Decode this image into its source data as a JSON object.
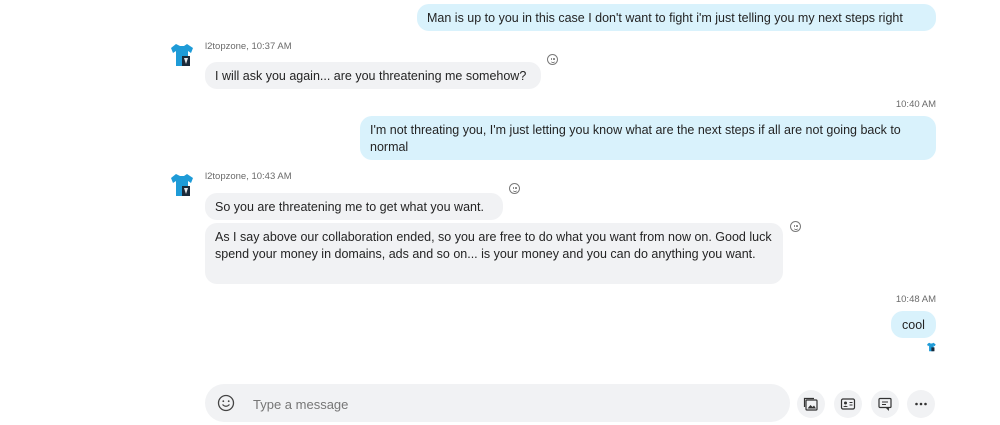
{
  "messages": [
    {
      "text": "Man is up to you in this case I don't want to fight i'm just telling you my next steps right"
    },
    {
      "sender": "l2topzone, 10:37 AM",
      "text": "I will ask you again... are you threatening me somehow?"
    },
    {
      "time": "10:40 AM",
      "text": "I'm not threating you, I'm just letting you know what are the next steps if all are not going back to normal"
    },
    {
      "sender": "l2topzone, 10:43 AM",
      "text": "So you are threatening me to get what you want."
    },
    {
      "text": "As I say above our collaboration ended, so you are free to do what you want from now on. Good luck spend your money in domains, ads and so on... is your money and you can do anything you want."
    },
    {
      "time": "10:48 AM",
      "text": "cool"
    }
  ],
  "composer": {
    "placeholder": "Type a message"
  },
  "icons": {
    "emoji": "emoji-icon",
    "reaction": "smiley-reaction-icon",
    "avatar": "shirt-avatar-icon",
    "media": "image-gallery-icon",
    "contact": "contact-card-icon",
    "present": "screen-share-icon",
    "more": "more-options-icon"
  },
  "colors": {
    "outgoing": "#d9f2fc",
    "incoming": "#f1f2f4",
    "avatar": "#1e9bd7"
  }
}
